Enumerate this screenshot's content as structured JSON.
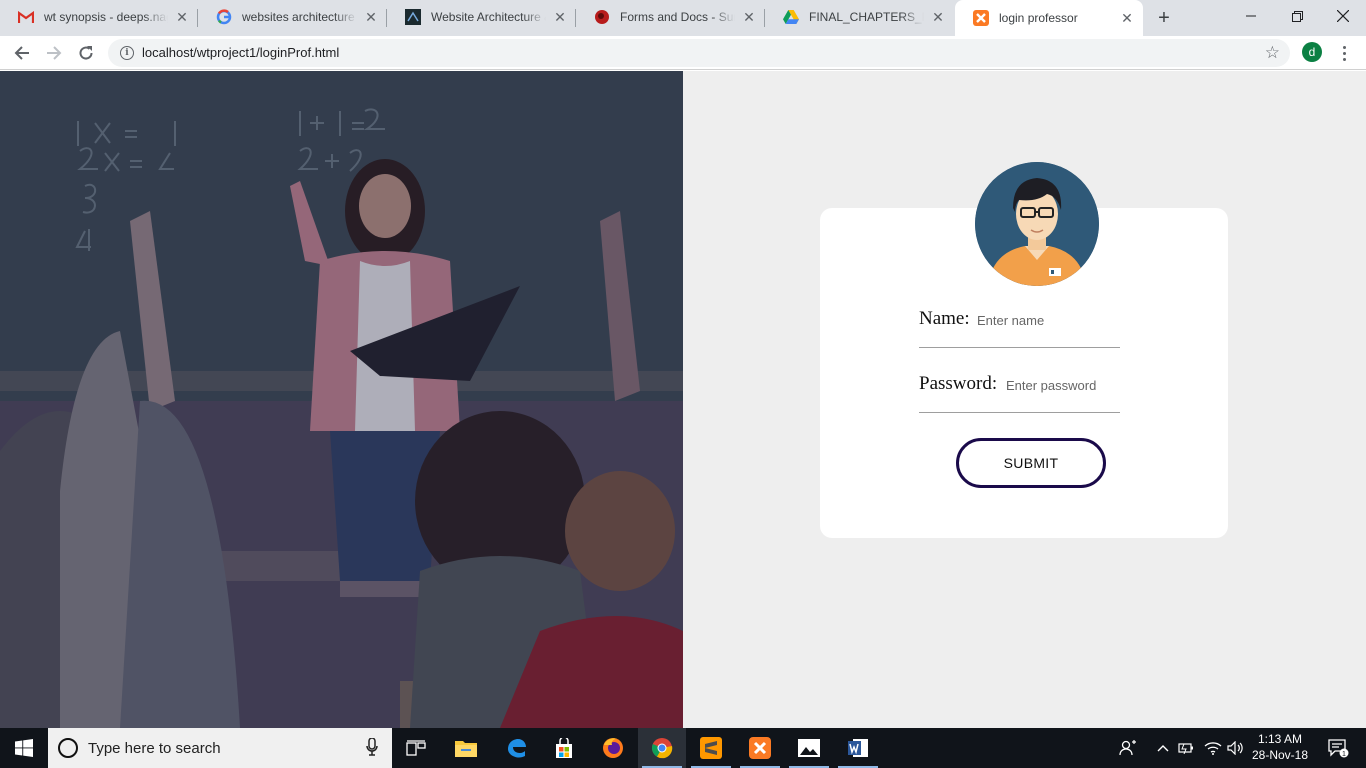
{
  "browser": {
    "tabs": [
      {
        "title": "wt synopsis - deeps.nag",
        "icon": "gmail-icon"
      },
      {
        "title": "websites architecture - G",
        "icon": "google-icon"
      },
      {
        "title": "Website Architecture &",
        "icon": "site-icon"
      },
      {
        "title": "Forms and Docs - Suma",
        "icon": "shield-icon"
      },
      {
        "title": "FINAL_CHAPTERS_PAGE",
        "icon": "drive-icon"
      },
      {
        "title": "login professor",
        "icon": "xampp-icon",
        "active": true
      }
    ],
    "url": "localhost/wtproject1/loginProf.html",
    "profile_initial": "d"
  },
  "login": {
    "name_label": "Name:",
    "name_placeholder": "Enter name",
    "password_label": "Password:",
    "password_placeholder": "Enter password",
    "submit_label": "SUBMIT"
  },
  "taskbar": {
    "search_placeholder": "Type here to search",
    "time": "1:13 AM",
    "date": "28-Nov-18",
    "notification_count": "1"
  },
  "colors": {
    "card_bg": "#ffffff",
    "page_bg": "#eeeeee",
    "submit_border": "#1a0a4a",
    "avatar_bg": "#2f5978"
  }
}
